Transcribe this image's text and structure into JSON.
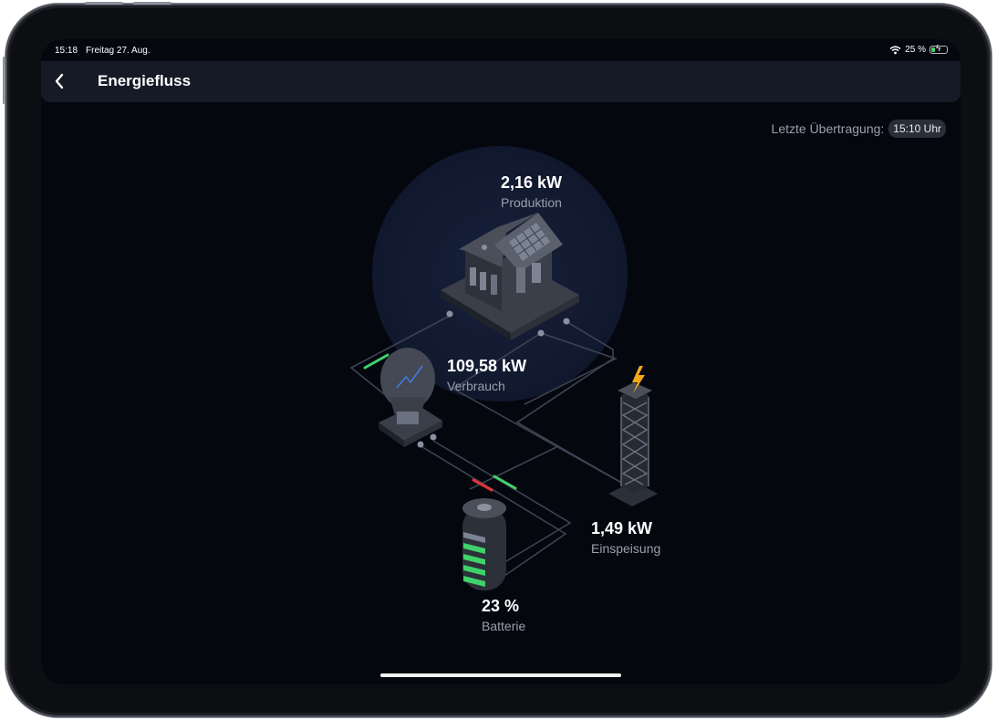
{
  "status_bar": {
    "time": "15:18",
    "date": "Freitag 27. Aug.",
    "battery_percent": "25 %",
    "battery_level": 0.25
  },
  "header": {
    "title": "Energiefluss"
  },
  "last_transfer": {
    "label": "Letzte Übertragung:",
    "time": "15:10 Uhr"
  },
  "nodes": {
    "production": {
      "value": "2,16 kW",
      "label": "Produktion",
      "icon": "solar-house-icon"
    },
    "consumption": {
      "value": "109,58 kW",
      "label": "Verbrauch",
      "icon": "light-bulb-icon"
    },
    "feed_in": {
      "value": "1,49 kW",
      "label": "Einspeisung",
      "icon": "power-tower-icon"
    },
    "battery": {
      "value": "23 %",
      "label": "Batterie",
      "icon": "battery-icon"
    }
  },
  "colors": {
    "background": "#05070f",
    "navbar": "#161a26",
    "flow_in": "#3fd26a",
    "flow_out": "#e0343a",
    "bolt": "#f3a81a"
  }
}
